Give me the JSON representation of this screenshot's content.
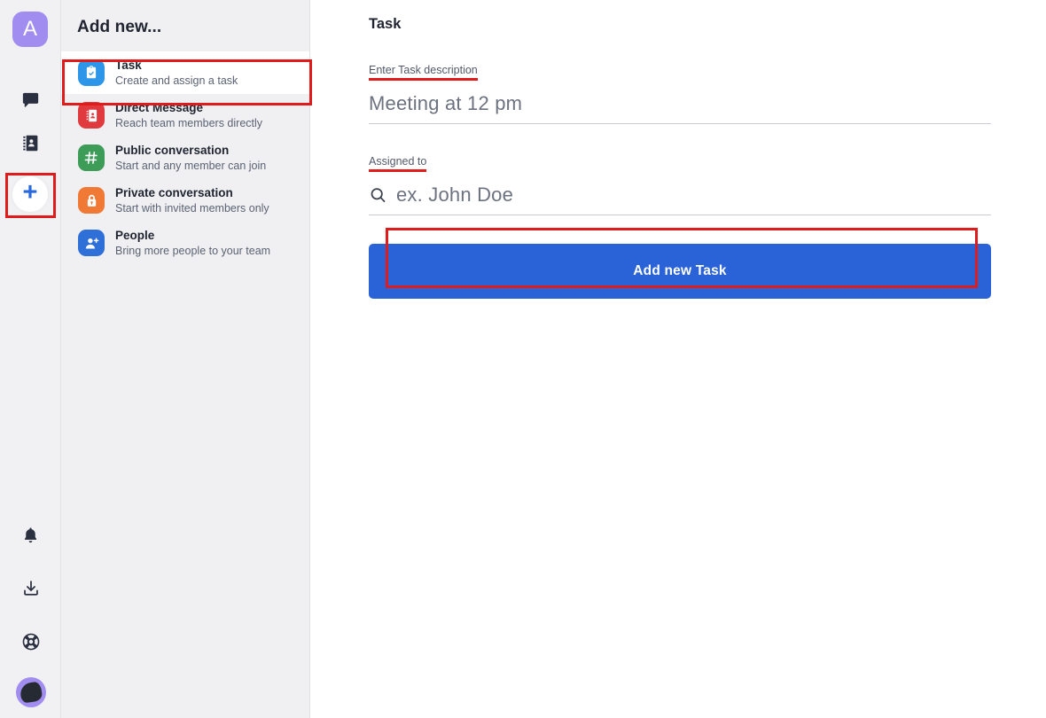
{
  "rail": {
    "workspace_avatar_letter": "A",
    "icons": [
      {
        "name": "chat-icon",
        "label": "Chats"
      },
      {
        "name": "contacts-icon",
        "label": "Contacts"
      },
      {
        "name": "add-new-icon",
        "label": "Add new"
      }
    ],
    "bottom_icons": [
      {
        "name": "bell-icon",
        "label": "Notifications"
      },
      {
        "name": "download-icon",
        "label": "Downloads"
      },
      {
        "name": "help-icon",
        "label": "Help"
      },
      {
        "name": "user-avatar",
        "label": "Profile"
      }
    ],
    "plus_glyph": "+"
  },
  "panel": {
    "title": "Add new...",
    "items": [
      {
        "title": "Task",
        "subtitle": "Create and assign a task",
        "icon": "clipboard-check-icon",
        "color": "#2e96e8",
        "selected": true
      },
      {
        "title": "Direct Message",
        "subtitle": "Reach team members directly",
        "icon": "address-book-icon",
        "color": "#e0393e",
        "selected": false
      },
      {
        "title": "Public conversation",
        "subtitle": "Start and any member can join",
        "icon": "hash-icon",
        "color": "#3d9d58",
        "selected": false
      },
      {
        "title": "Private conversation",
        "subtitle": "Start with invited members only",
        "icon": "lock-icon",
        "color": "#f07a35",
        "selected": false
      },
      {
        "title": "People",
        "subtitle": "Bring more people to your team",
        "icon": "user-plus-icon",
        "color": "#2f6fd8",
        "selected": false
      }
    ]
  },
  "content": {
    "title": "Task",
    "description_field": {
      "label": "Enter Task description",
      "value": "Meeting at 12 pm"
    },
    "assigned_field": {
      "label": "Assigned to",
      "placeholder": "ex. John Doe",
      "icon": "search-icon"
    },
    "submit_label": "Add new Task"
  },
  "colors": {
    "accent_blue": "#2a62d8",
    "annotation_red": "#e01b1b",
    "panel_bg": "#f0f0f2",
    "rail_bg": "#f1f1f3"
  }
}
